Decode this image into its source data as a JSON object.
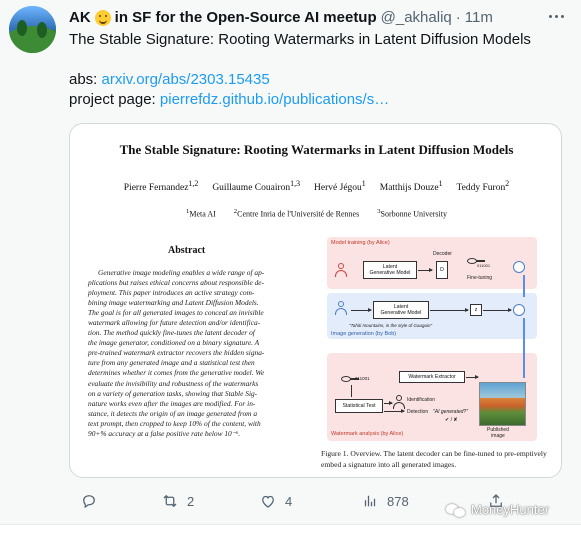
{
  "tweet": {
    "author_name": "AK",
    "author_suffix": "in SF for the Open-Source AI meetup",
    "emoji": "hugging-face-emoji",
    "handle": "@_akhaliq",
    "separator": "·",
    "time": "11m",
    "text_line1": "The Stable Signature: Rooting Watermarks in Latent Diffusion Models",
    "abs_prefix": "abs: ",
    "abs_link": "arxiv.org/abs/2303.15435",
    "project_prefix": "project page: ",
    "project_link": "pierrefdz.github.io/publications/s…"
  },
  "paper": {
    "title": "The Stable Signature: Rooting Watermarks in Latent Diffusion Models",
    "authors": [
      {
        "name": "Pierre Fernandez",
        "sup": "1,2"
      },
      {
        "name": "Guillaume Couairon",
        "sup": "1,3"
      },
      {
        "name": "Hervé Jégou",
        "sup": "1"
      },
      {
        "name": "Matthijs Douze",
        "sup": "1"
      },
      {
        "name": "Teddy Furon",
        "sup": "2"
      }
    ],
    "affiliations": [
      {
        "sup": "1",
        "name": "Meta AI"
      },
      {
        "sup": "2",
        "name": "Centre Inria de l'Université de Rennes"
      },
      {
        "sup": "3",
        "name": "Sorbonne University"
      }
    ],
    "abstract_heading": "Abstract",
    "abstract_lines": [
      "Generative image modeling enables a wide range of ap-",
      "plications but raises ethical concerns about responsible de-",
      "ployment.  This paper introduces an active strategy com-",
      "bining image watermarking and Latent Diffusion Models.",
      "The goal is for all generated images to conceal an invisible",
      "watermark allowing for future detection and/or identifica-",
      "tion.  The method quickly fine-tunes the latent decoder of",
      "the image generator, conditioned on a binary signature. A",
      "pre-trained watermark extractor recovers the hidden signa-",
      "ture from any generated image and a statistical test then",
      "determines whether it comes from the generative model. We",
      "evaluate the invisibility and robustness of the watermarks",
      "on a variety of generation tasks, showing that Stable Sig-",
      "nature works even after the images are modified.  For in-",
      "stance, it detects the origin of an image generated from a",
      "text prompt, then cropped to keep 10% of the content, with",
      "90+% accuracy at a false positive rate below 10⁻⁶."
    ],
    "figure": {
      "band1_label": "Model training (by Alice)",
      "band2_label": "Image generation (by Bob)",
      "band3_label": "Watermark analysis (by Alice)",
      "latent_gen_1": "Latent\nGenerative Model",
      "decoder_label": "Decoder",
      "decoder_box": "D",
      "key_bits_1": "011001",
      "fine_tuning": "Fine-tuning",
      "latent_gen_2": "Latent\nGenerative Model",
      "z_box": "z",
      "prompt": "\"Tahiti mountains, in the style of Gauguin\"",
      "key_bits_2": "011001",
      "extractor": "Watermark Extractor",
      "stat_test": "Statistical Test",
      "identification": "Identification",
      "detection": "Detection",
      "ai_generated": "\"AI generated?\"",
      "check": "✔ / ✘",
      "published": "Published\nimage"
    },
    "caption": "Figure 1.  Overview. The latent decoder can be fine-tuned to pre-emptively embed a signature into all generated images."
  },
  "actions": {
    "reply_count": "",
    "retweet_count": "2",
    "like_count": "4",
    "views_count": "878"
  },
  "watermark_text": "MoneyHunter",
  "colors": {
    "link": "#1d9bf0",
    "muted": "#536471",
    "band_red": "#fbe3e3",
    "band_blue": "#e3ecfb",
    "label_red": "#c0392b",
    "label_blue": "#2e5eaa"
  }
}
